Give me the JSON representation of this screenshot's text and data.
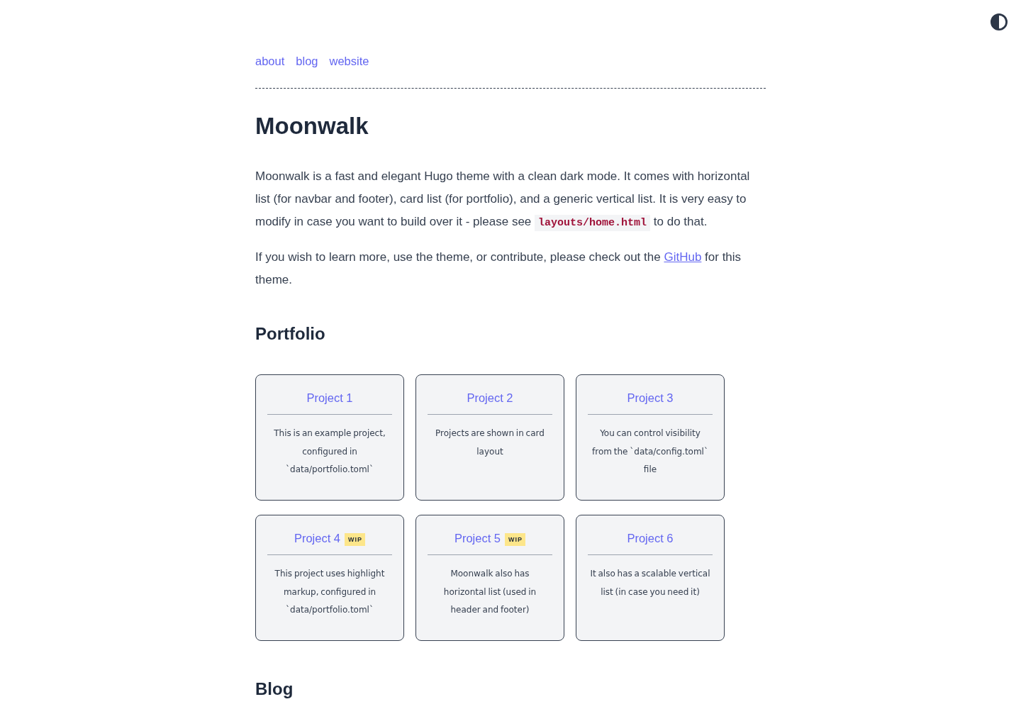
{
  "nav": {
    "links": [
      "about",
      "blog",
      "website"
    ]
  },
  "title": "Moonwalk",
  "intro": [
    {
      "parts": [
        {
          "kind": "text",
          "text": "Moonwalk is a fast and elegant Hugo theme with a clean dark mode. It comes with horizontal list (for navbar and footer), card list (for portfolio), and a generic vertical list. It is very easy to modify in case you want to build over it - please see "
        },
        {
          "kind": "code",
          "text": "layouts/home.html"
        },
        {
          "kind": "text",
          "text": " to do that."
        }
      ]
    },
    {
      "parts": [
        {
          "kind": "text",
          "text": "If you wish to learn more, use the theme, or contribute, please check out the "
        },
        {
          "kind": "link",
          "text": "GitHub"
        },
        {
          "kind": "text",
          "text": " for this theme."
        }
      ]
    }
  ],
  "portfolio": {
    "heading": "Portfolio",
    "cards": [
      {
        "title": "Project 1",
        "description": "This is an example project, configured in `data/portfolio.toml`"
      },
      {
        "title": "Project 2",
        "description": "Projects are shown in card layout"
      },
      {
        "title": "Project 3",
        "description": "You can control visibility from the `data/config.toml` file"
      },
      {
        "title": "Project 4",
        "badge": "WIP",
        "description": "This project uses highlight markup, configured in `data/portfolio.toml`"
      },
      {
        "title": "Project 5",
        "badge": "WIP",
        "description": "Moonwalk also has horizontal list (used in header and footer)"
      },
      {
        "title": "Project 6",
        "description": "It also has a scalable vertical list (in case you need it)"
      }
    ]
  },
  "blog": {
    "heading": "Blog"
  }
}
